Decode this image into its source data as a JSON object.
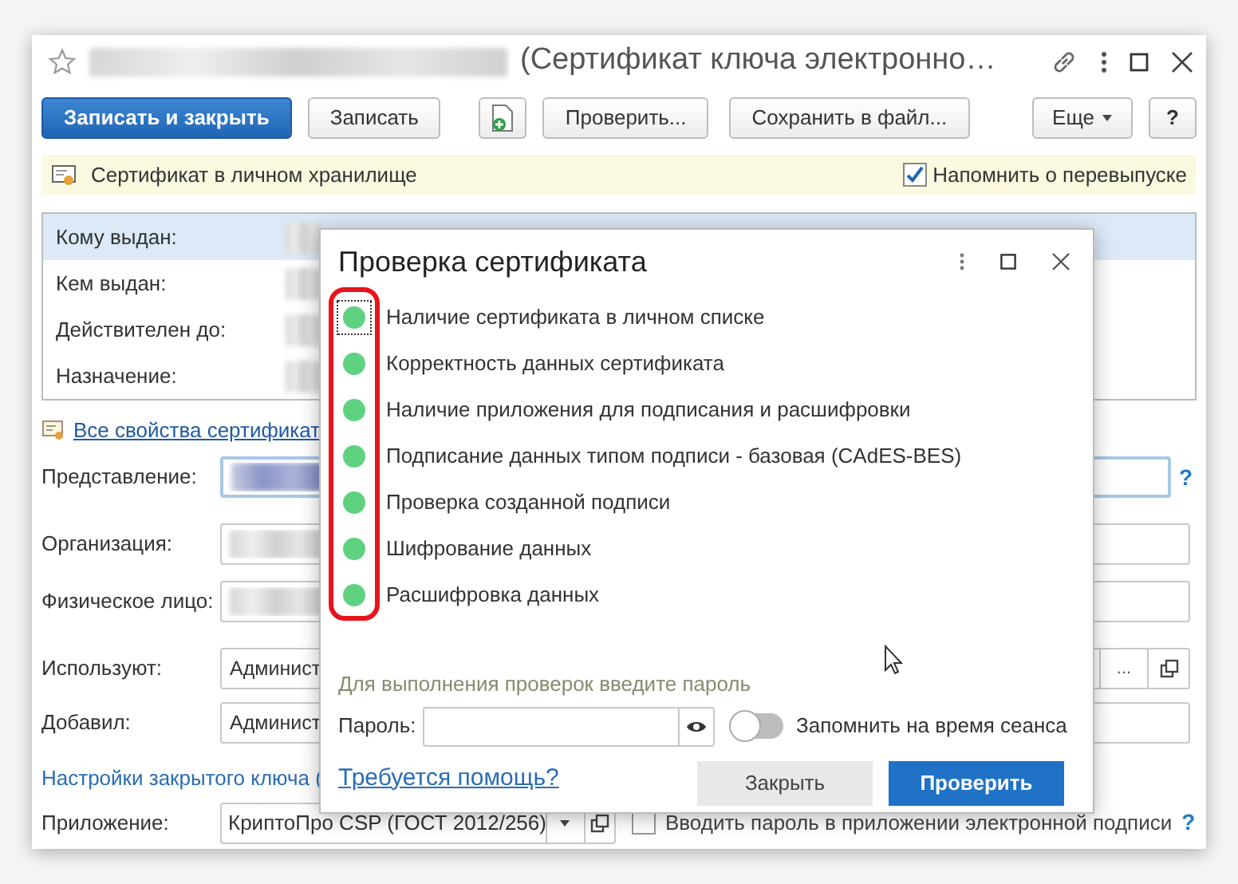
{
  "window": {
    "title": "(Сертификат ключа электронно…"
  },
  "toolbar": [
    {
      "kind": "primary",
      "label": "Записать и закрыть"
    },
    {
      "kind": "default",
      "label": "Записать"
    },
    {
      "kind": "icon"
    },
    {
      "kind": "default",
      "label": "Проверить..."
    },
    {
      "kind": "default",
      "label": "Сохранить в файл..."
    },
    {
      "kind": "menu",
      "label": "Еще"
    },
    {
      "kind": "help",
      "label": "?"
    }
  ],
  "info_bar": {
    "text": "Сертификат в личном хранилище",
    "remind": {
      "label": "Напомнить о перевыпуске",
      "checked": true
    }
  },
  "details": [
    {
      "label": "Кому выдан:",
      "selected": true
    },
    {
      "label": "Кем выдан:",
      "selected": false
    },
    {
      "label": "Действителен до:",
      "selected": false
    },
    {
      "label": "Назначение:",
      "selected": false
    }
  ],
  "all_properties_link": "Все свойства сертификат",
  "fields": [
    {
      "label": "Представление:",
      "kind": "input",
      "focused": true,
      "help": "?"
    },
    {
      "label": "Организация:",
      "kind": "input",
      "focused": false
    },
    {
      "label": "Физическое лицо:",
      "kind": "input",
      "focused": false
    },
    {
      "label": "Используют:",
      "kind": "select",
      "focused": false,
      "value": "Админист",
      "select_button": "..."
    },
    {
      "label": "Добавил:",
      "kind": "input",
      "focused": false,
      "value": "Админист"
    }
  ],
  "key_settings": {
    "title": "Настройки закрытого ключа (",
    "application": {
      "label": "Приложение:",
      "value": "КриптоПро CSP (ГОСТ 2012/256)"
    },
    "ask_password": {
      "label": "Вводить пароль в приложении электронной подписи",
      "checked": false
    },
    "help": "?"
  },
  "dialog": {
    "title": "Проверка сертификата",
    "checks": [
      {
        "label": "Наличие сертификата в личном списке",
        "color": "#5fd27f",
        "focused": true
      },
      {
        "label": "Корректность данных сертификата",
        "color": "#5fd27f",
        "focused": false
      },
      {
        "label": "Наличие приложения для подписания и расшифровки",
        "color": "#5fd27f",
        "focused": false
      },
      {
        "label": "Подписание данных типом подписи - базовая (CAdES-BES)",
        "color": "#5fd27f",
        "focused": false
      },
      {
        "label": "Проверка созданной подписи",
        "color": "#5fd27f",
        "focused": false
      },
      {
        "label": "Шифрование данных",
        "color": "#5fd27f",
        "focused": false
      },
      {
        "label": "Расшифровка данных",
        "color": "#5fd27f",
        "focused": false
      }
    ],
    "hint": "Для выполнения проверок введите пароль",
    "password": {
      "label": "Пароль:"
    },
    "remember": {
      "label": "Запомнить на время сеанса",
      "on": false
    },
    "help_link": "Требуется помощь?",
    "buttons": [
      {
        "kind": "secondary",
        "label": "Закрыть"
      },
      {
        "kind": "primary",
        "label": "Проверить"
      }
    ]
  }
}
